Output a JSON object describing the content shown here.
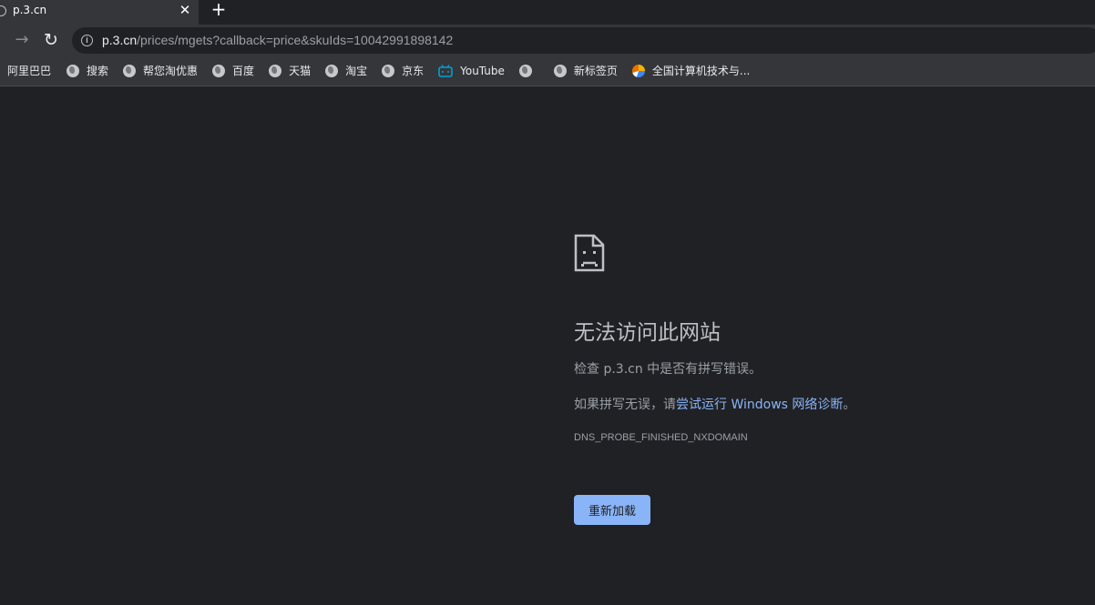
{
  "tab": {
    "title": "p.3.cn",
    "close": "✕",
    "new_tab": "+"
  },
  "toolbar": {
    "forward": "→",
    "reload": "↻",
    "url_host": "p.3.cn",
    "url_path": "/prices/mgets?callback=price&skuIds=10042991898142"
  },
  "bookmarks": [
    {
      "label": "阿里巴巴",
      "icon": "none"
    },
    {
      "label": "搜索",
      "icon": "globe-icon"
    },
    {
      "label": "帮您淘优惠",
      "icon": "globe-icon"
    },
    {
      "label": "百度",
      "icon": "globe-icon"
    },
    {
      "label": "天猫",
      "icon": "globe-icon"
    },
    {
      "label": "淘宝",
      "icon": "globe-icon"
    },
    {
      "label": "京东",
      "icon": "globe-icon"
    },
    {
      "label": "YouTube",
      "icon": "bilibili-icon"
    },
    {
      "label": "",
      "icon": "globe-icon"
    },
    {
      "label": "新标签页",
      "icon": "globe-icon"
    },
    {
      "label": "全国计算机技术与...",
      "icon": "site-icon"
    }
  ],
  "error": {
    "title": "无法访问此网站",
    "line1": "检查 p.3.cn 中是否有拼写错误。",
    "line2_prefix": "如果拼写无误，请",
    "line2_link": "尝试运行 Windows 网络诊断",
    "line2_suffix": "。",
    "code": "DNS_PROBE_FINISHED_NXDOMAIN",
    "reload_label": "重新加载"
  },
  "colors": {
    "background": "#202124",
    "toolbar": "#35363a",
    "link": "#8ab4f8",
    "button": "#8ab4f8"
  }
}
